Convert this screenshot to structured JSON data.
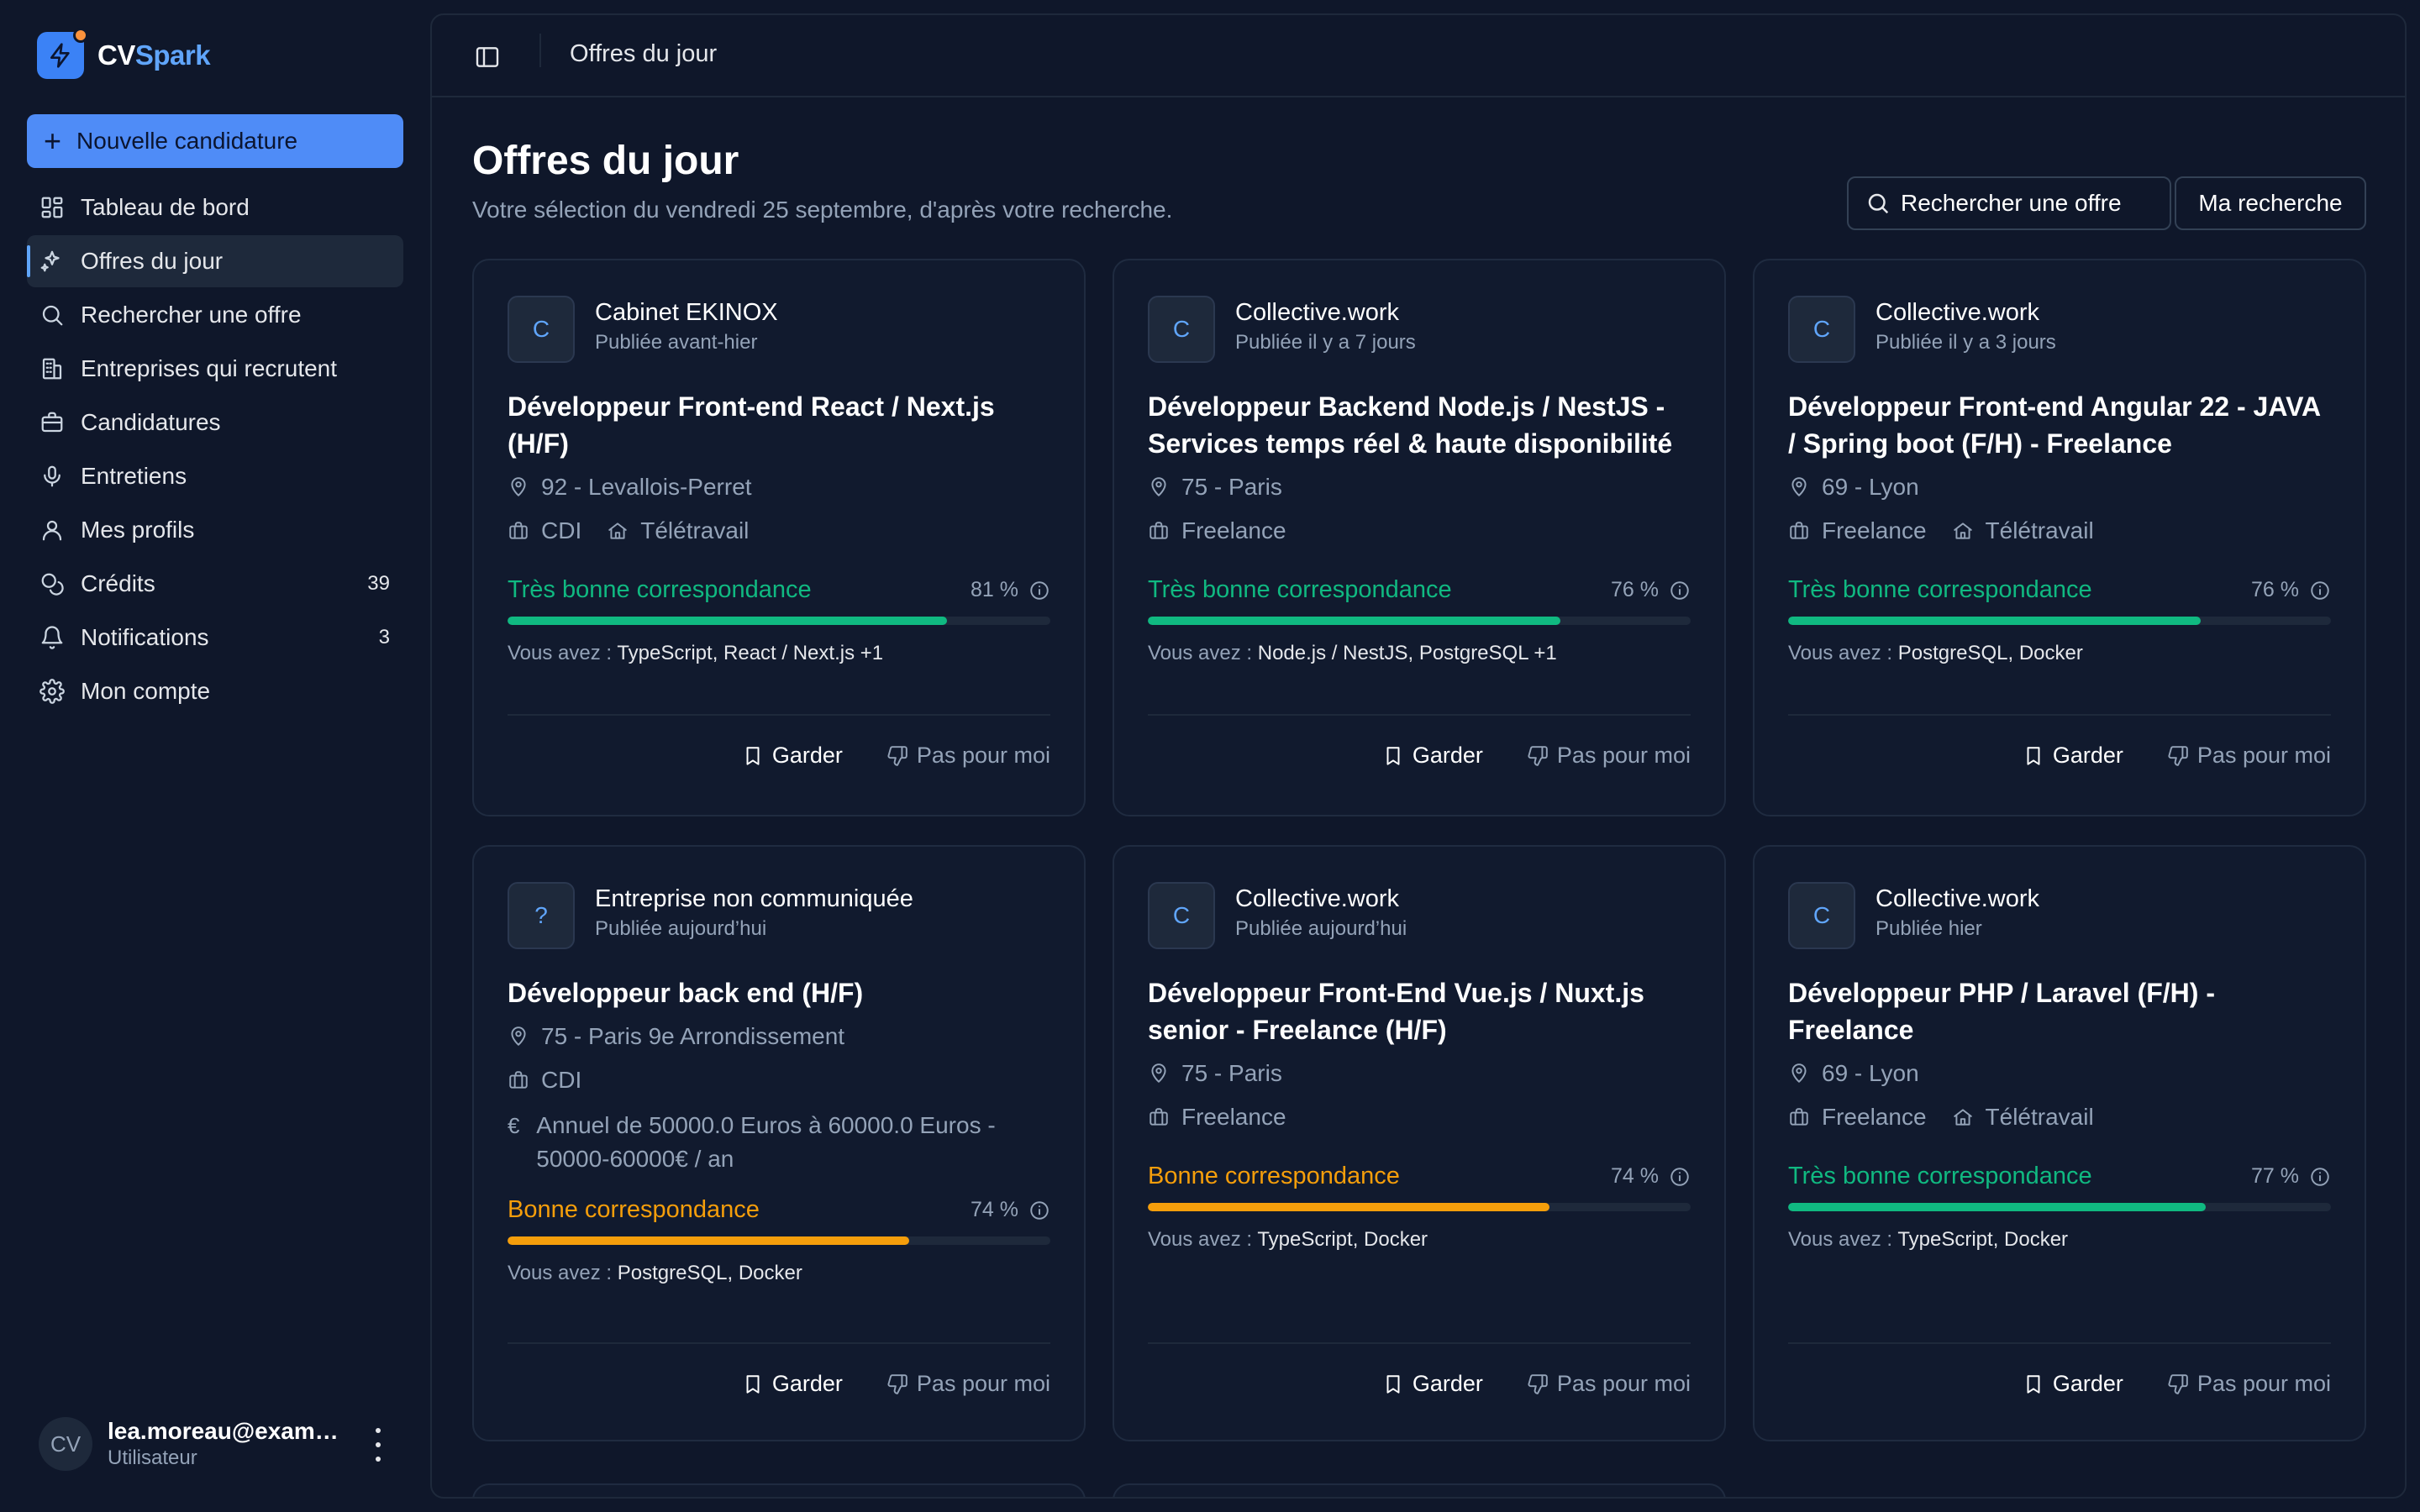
{
  "app": {
    "name_prefix": "CV",
    "name_suffix": "Spark"
  },
  "sidebar": {
    "new_button": "Nouvelle candidature",
    "items": [
      {
        "label": "Tableau de bord",
        "icon": "dashboard-icon"
      },
      {
        "label": "Offres du jour",
        "icon": "sparkles-icon",
        "active": true
      },
      {
        "label": "Rechercher une offre",
        "icon": "search-icon"
      },
      {
        "label": "Entreprises qui recrutent",
        "icon": "building-icon"
      },
      {
        "label": "Candidatures",
        "icon": "briefcase-icon"
      },
      {
        "label": "Entretiens",
        "icon": "mic-icon"
      },
      {
        "label": "Mes profils",
        "icon": "user-icon"
      },
      {
        "label": "Crédits",
        "icon": "coins-icon",
        "badge": "39"
      },
      {
        "label": "Notifications",
        "icon": "bell-icon",
        "badge": "3"
      },
      {
        "label": "Mon compte",
        "icon": "gear-icon"
      }
    ]
  },
  "user": {
    "initials": "CV",
    "email": "lea.moreau@example.com",
    "role": "Utilisateur"
  },
  "topbar": {
    "title": "Offres du jour"
  },
  "header": {
    "title": "Offres du jour",
    "subtitle": "Votre sélection du vendredi 25 septembre, d'après votre recherche.",
    "search_button": "Rechercher une offre",
    "my_search_button": "Ma recherche"
  },
  "labels": {
    "you_have": "Vous avez :",
    "keep": "Garder",
    "not_for_me": "Pas pour moi"
  },
  "cards": [
    {
      "logo": "C",
      "company": "Cabinet EKINOX",
      "posted": "Publiée avant-hier",
      "title": "Développeur Front-end React / Next.js (H/F)",
      "location": "92 - Levallois-Perret",
      "contract": "CDI",
      "remote": "Télétravail",
      "match_label": "Très bonne correspondance",
      "match_level": "great",
      "match_pct": "81 %",
      "match_value": 0.81,
      "skills": "TypeScript, React / Next.js +1"
    },
    {
      "logo": "C",
      "company": "Collective.work",
      "posted": "Publiée il y a 7 jours",
      "title": "Développeur Backend Node.js / NestJS - Services temps réel & haute disponibilité",
      "location": "75 - Paris",
      "contract": "Freelance",
      "remote": "",
      "match_label": "Très bonne correspondance",
      "match_level": "great",
      "match_pct": "76 %",
      "match_value": 0.76,
      "skills": "Node.js / NestJS, PostgreSQL +1"
    },
    {
      "logo": "C",
      "company": "Collective.work",
      "posted": "Publiée il y a 3 jours",
      "title": "Développeur Front-end Angular 22 - JAVA / Spring boot (F/H) - Freelance",
      "location": "69 - Lyon",
      "contract": "Freelance",
      "remote": "Télétravail",
      "match_label": "Très bonne correspondance",
      "match_level": "great",
      "match_pct": "76 %",
      "match_value": 0.76,
      "skills": "PostgreSQL, Docker"
    },
    {
      "logo": "?",
      "company": "Entreprise non communiquée",
      "posted": "Publiée aujourd’hui",
      "title": "Développeur back end (H/F)",
      "location": "75 - Paris 9e Arrondissement",
      "contract": "CDI",
      "remote": "",
      "salary": "Annuel de 50000.0 Euros à 60000.0 Euros - 50000-60000€ / an",
      "match_label": "Bonne correspondance",
      "match_level": "good",
      "match_pct": "74 %",
      "match_value": 0.74,
      "skills": "PostgreSQL, Docker"
    },
    {
      "logo": "C",
      "company": "Collective.work",
      "posted": "Publiée aujourd’hui",
      "title": "Développeur Front-End Vue.js / Nuxt.js senior - Freelance (H/F)",
      "location": "75 - Paris",
      "contract": "Freelance",
      "remote": "",
      "match_label": "Bonne correspondance",
      "match_level": "good",
      "match_pct": "74 %",
      "match_value": 0.74,
      "skills": "TypeScript, Docker"
    },
    {
      "logo": "C",
      "company": "Collective.work",
      "posted": "Publiée hier",
      "title": "Développeur PHP / Laravel (F/H) - Freelance",
      "location": "69 - Lyon",
      "contract": "Freelance",
      "remote": "Télétravail",
      "match_label": "Très bonne correspondance",
      "match_level": "great",
      "match_pct": "77 %",
      "match_value": 0.77,
      "skills": "TypeScript, Docker"
    }
  ]
}
